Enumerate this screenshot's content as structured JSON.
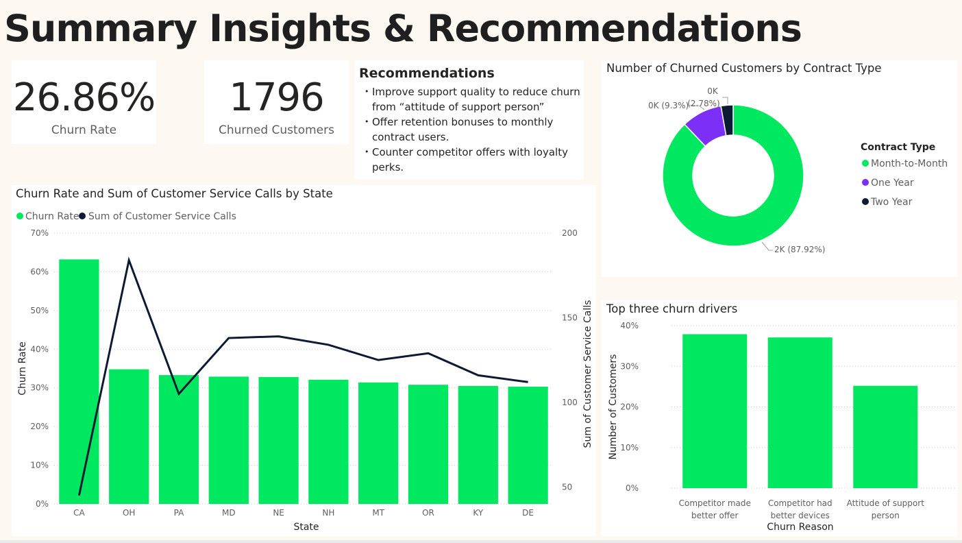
{
  "page": {
    "title": "Summary Insights & Recommendations"
  },
  "kpis": {
    "churn_rate": {
      "value": "26.86%",
      "label": "Churn Rate"
    },
    "churned_customers": {
      "value": "1796",
      "label": "Churned Customers"
    }
  },
  "recommendations": {
    "title": "Recommendations",
    "items": [
      "Improve support quality to reduce churn from “attitude of support person”",
      "Offer retention bonuses to monthly contract users.",
      "Counter competitor offers with loyalty perks."
    ]
  },
  "colors": {
    "green": "#00e85f",
    "purple": "#7b2ff7",
    "navy": "#0c1a33"
  },
  "chart_data": [
    {
      "id": "state_chart",
      "type": "bar",
      "title": "Churn Rate and Sum of Customer Service Calls by State",
      "legend": {
        "placement": "top-left",
        "entries": [
          "Churn Rate",
          "Sum of Customer Service Calls"
        ]
      },
      "xlabel": "State",
      "ylabel": "Churn Rate",
      "y2label": "Sum of Customer Service Calls",
      "categories": [
        "CA",
        "OH",
        "PA",
        "MD",
        "NE",
        "NH",
        "MT",
        "OR",
        "KY",
        "DE"
      ],
      "series": [
        {
          "name": "Churn Rate",
          "type": "bar",
          "axis": "left",
          "values": [
            63.2,
            34.8,
            33.3,
            32.9,
            32.8,
            32.1,
            31.4,
            30.8,
            30.5,
            30.3
          ]
        },
        {
          "name": "Sum of Customer Service Calls",
          "type": "line",
          "axis": "right",
          "values": [
            45,
            184,
            105,
            138,
            139,
            134,
            125,
            129,
            116,
            112
          ]
        }
      ],
      "ylim": [
        0,
        70
      ],
      "yticks": [
        "0%",
        "10%",
        "20%",
        "30%",
        "40%",
        "50%",
        "60%",
        "70%"
      ],
      "y2lim": [
        40,
        200
      ],
      "y2ticks": [
        "50",
        "100",
        "150",
        "200"
      ],
      "grid": true
    },
    {
      "id": "contract_chart",
      "type": "pie",
      "title": "Number of Churned Customers by Contract Type",
      "legend": {
        "title": "Contract Type",
        "placement": "right",
        "entries": [
          "Month-to-Month",
          "One Year",
          "Two Year"
        ]
      },
      "categories": [
        "Month-to-Month",
        "One Year",
        "Two Year"
      ],
      "values": [
        87.92,
        9.3,
        2.78
      ],
      "data_labels": [
        "2K (87.92%)",
        "0K (9.3%)",
        "0K (2.78%)"
      ]
    },
    {
      "id": "drivers_chart",
      "type": "bar",
      "title": "Top three churn drivers",
      "xlabel": "Churn Reason",
      "ylabel": "Number of Customers",
      "categories": [
        [
          "Competitor made",
          "better offer"
        ],
        [
          "Competitor had",
          "better devices"
        ],
        [
          "Attitude of support",
          "person"
        ]
      ],
      "values": [
        37.9,
        37.1,
        25.2
      ],
      "ylim": [
        0,
        40
      ],
      "yticks": [
        "0%",
        "10%",
        "20%",
        "30%",
        "40%"
      ],
      "grid": true
    }
  ]
}
